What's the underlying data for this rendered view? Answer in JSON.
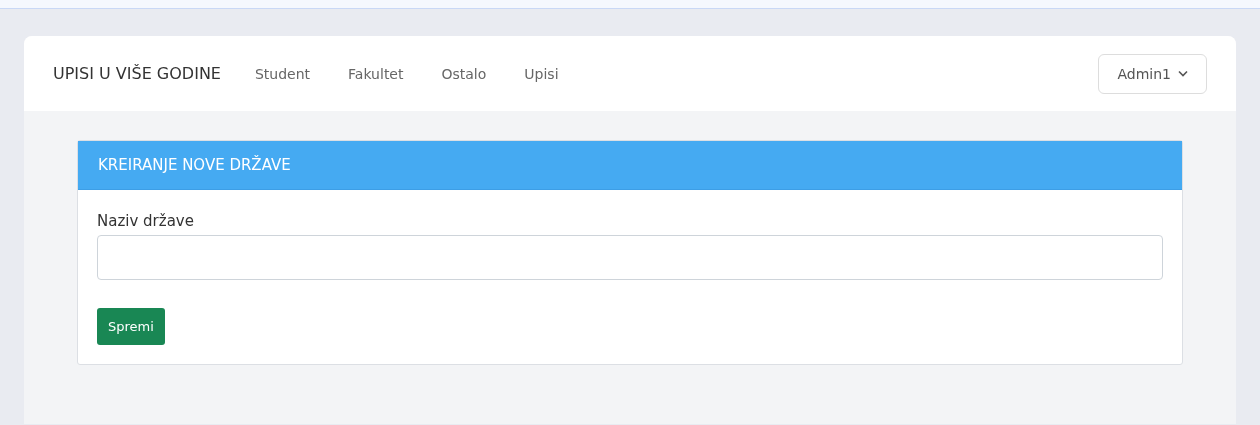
{
  "navbar": {
    "brand": "UPISI U VIŠE GODINE",
    "links": [
      {
        "label": "Student"
      },
      {
        "label": "Fakultet"
      },
      {
        "label": "Ostalo"
      },
      {
        "label": "Upisi"
      }
    ],
    "user_menu": {
      "label": "Admin1"
    }
  },
  "form_card": {
    "title": "KREIRANJE NOVE DRŽAVE",
    "field": {
      "label": "Naziv države"
    },
    "submit_button": "Spremi"
  }
}
